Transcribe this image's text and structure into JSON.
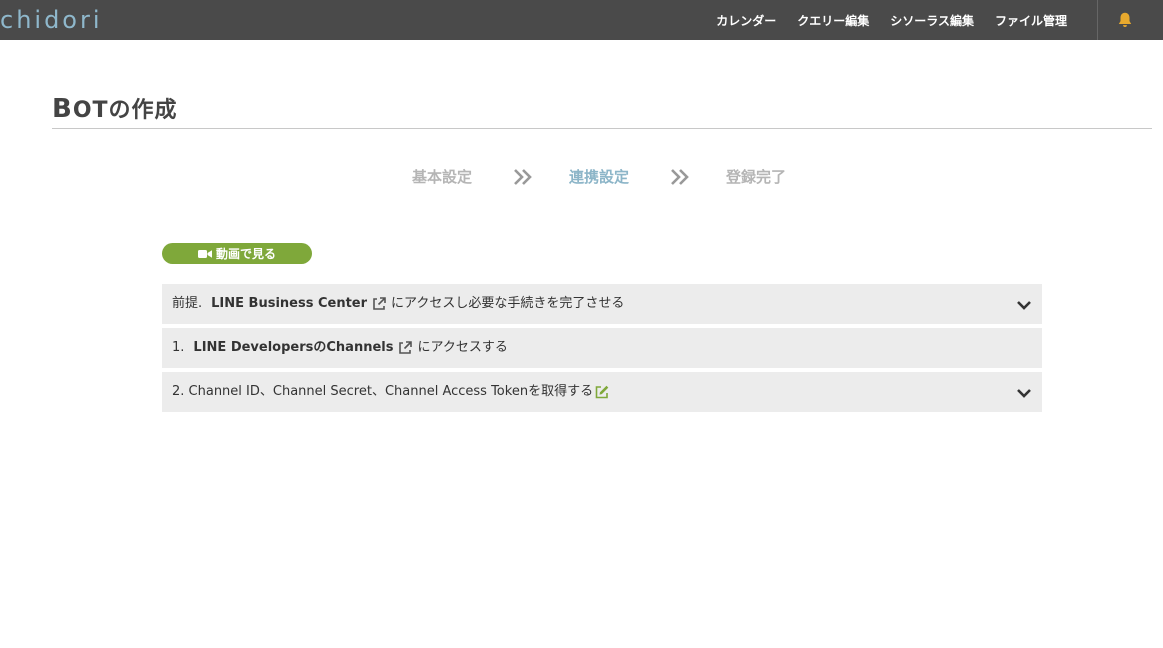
{
  "header": {
    "logo": "chidori",
    "nav": [
      "カレンダー",
      "クエリー編集",
      "シソーラス編集",
      "ファイル管理"
    ]
  },
  "page": {
    "title_first_letter": "B",
    "title_rest": "OTの作成"
  },
  "steps": {
    "items": [
      "基本設定",
      "連携設定",
      "登録完了"
    ],
    "active_index": 1
  },
  "video_button": {
    "label": "動画で見る"
  },
  "accordion": {
    "item0": {
      "prefix": "前提.",
      "link": "LINE Business Center",
      "suffix": "にアクセスし必要な手続きを完了させる"
    },
    "item1": {
      "prefix": "1.",
      "link": "LINE DevelopersのChannels",
      "suffix": "にアクセスする"
    },
    "item2": {
      "text": "2. Channel ID、Channel Secret、Channel Access Tokenを取得する"
    }
  },
  "colors": {
    "topbar": "#4a4a4a",
    "logo": "#8fb8cc",
    "active_step": "#8cb5c8",
    "video_button": "#7fa83a",
    "bell": "#e8a92e",
    "accordion_bg": "#ececec"
  }
}
